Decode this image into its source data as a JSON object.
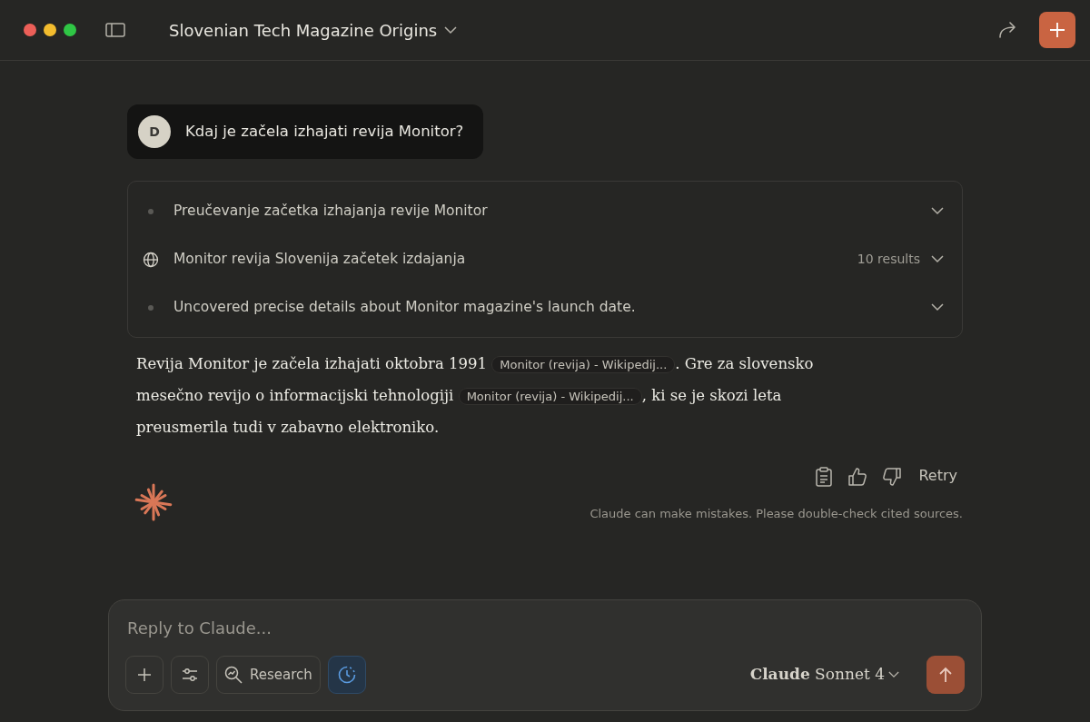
{
  "window": {
    "title": "Slovenian Tech Magazine Origins"
  },
  "user_message": {
    "avatar": "D",
    "text": "Kdaj je začela izhajati revija Monitor?"
  },
  "steps": [
    {
      "kind": "dot",
      "text": "Preučevanje začetka izhajanja revije Monitor"
    },
    {
      "kind": "web",
      "text": "Monitor revija Slovenija začetek izdajanja",
      "count": "10 results"
    },
    {
      "kind": "dot",
      "text": "Uncovered precise details about Monitor magazine's launch date."
    }
  ],
  "answer": [
    {
      "kind": "text",
      "text": "Revija Monitor je začela izhajati oktobra 1991 "
    },
    {
      "kind": "citation",
      "text": "Monitor (revija) - Wikipedij..."
    },
    {
      "kind": "text",
      "text": ". Gre za slovensko mesečno revijo o informacijski tehnologiji "
    },
    {
      "kind": "citation",
      "text": "Monitor (revija) - Wikipedij..."
    },
    {
      "kind": "text",
      "text": ", ki se je skozi leta preusmerila tudi v zabavno elektroniko."
    }
  ],
  "actions": {
    "retry": "Retry"
  },
  "disclaimer": "Claude can make mistakes. Please double-check cited sources.",
  "composer": {
    "placeholder": "Reply to Claude...",
    "tools": [
      {
        "kind": "add",
        "on": false
      },
      {
        "kind": "settings",
        "on": false
      },
      {
        "kind": "research",
        "label": "Research",
        "on": false
      },
      {
        "kind": "thinking",
        "on": true
      }
    ],
    "model": "**Claude** Sonnet 4"
  }
}
